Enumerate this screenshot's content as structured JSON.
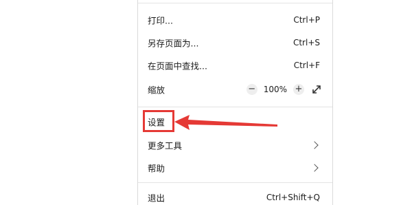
{
  "menu": {
    "items": [
      {
        "label": "打印...",
        "shortcut": "Ctrl+P"
      },
      {
        "label": "另存页面为...",
        "shortcut": "Ctrl+S"
      },
      {
        "label": "在页面中查找...",
        "shortcut": "Ctrl+F"
      }
    ],
    "zoom": {
      "label": "缩放",
      "minus": "−",
      "value": "100%",
      "plus": "+"
    },
    "settings": {
      "label": "设置"
    },
    "more_tools": {
      "label": "更多工具"
    },
    "help": {
      "label": "帮助"
    },
    "exit": {
      "label": "退出",
      "shortcut": "Ctrl+Shift+Q"
    }
  },
  "annotation": {
    "color": "#e53935"
  }
}
